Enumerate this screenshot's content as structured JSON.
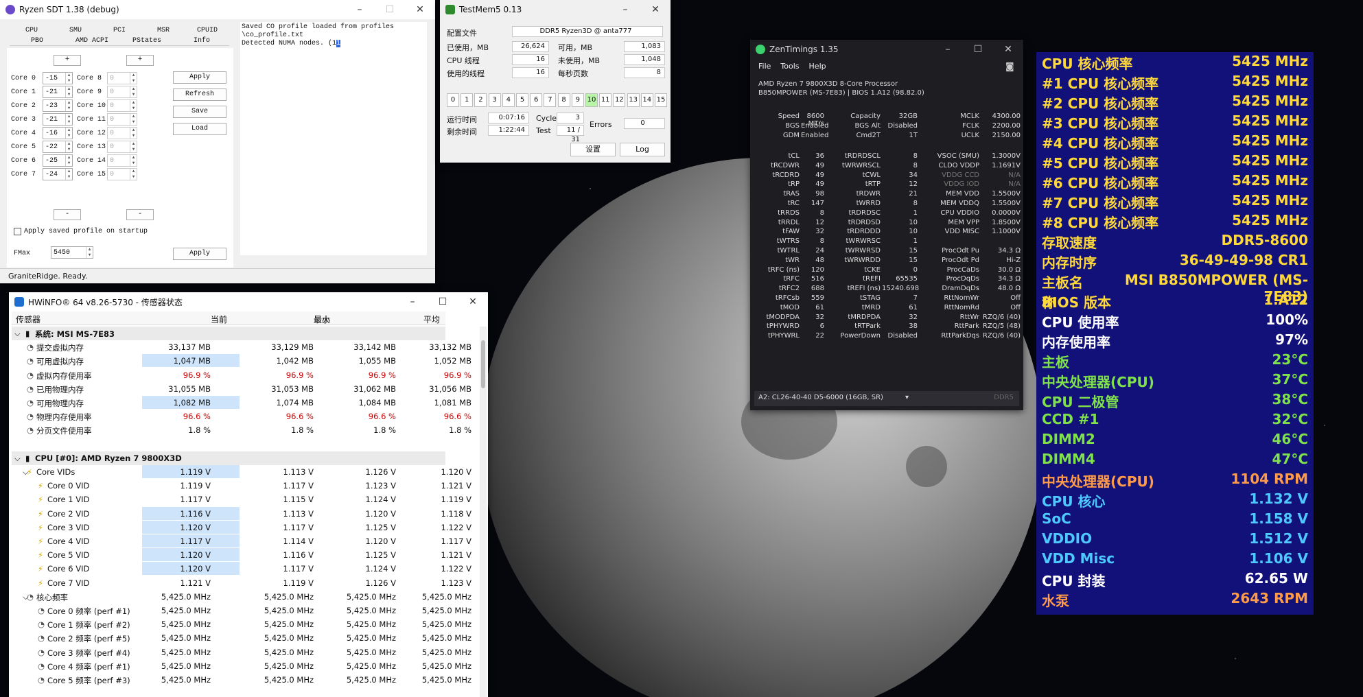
{
  "sdt": {
    "title": "Ryzen SDT 1.38 (debug)",
    "tabs_row1": [
      "CPU",
      "SMU",
      "PCI",
      "MSR",
      "CPUID"
    ],
    "tabs_row2": [
      "PBO",
      "AMD ACPI",
      "PStates",
      "Info"
    ],
    "plus": "+",
    "minus": "-",
    "cores_left": [
      {
        "label": "Core 0",
        "value": "-15"
      },
      {
        "label": "Core 1",
        "value": "-21"
      },
      {
        "label": "Core 2",
        "value": "-23"
      },
      {
        "label": "Core 3",
        "value": "-21"
      },
      {
        "label": "Core 4",
        "value": "-16"
      },
      {
        "label": "Core 5",
        "value": "-22"
      },
      {
        "label": "Core 6",
        "value": "-25"
      },
      {
        "label": "Core 7",
        "value": "-24"
      }
    ],
    "cores_right": [
      {
        "label": "Core 8",
        "value": "0"
      },
      {
        "label": "Core 9",
        "value": "0"
      },
      {
        "label": "Core 10",
        "value": "0"
      },
      {
        "label": "Core 11",
        "value": "0"
      },
      {
        "label": "Core 12",
        "value": "0"
      },
      {
        "label": "Core 13",
        "value": "0"
      },
      {
        "label": "Core 14",
        "value": "0"
      },
      {
        "label": "Core 15",
        "value": "0"
      }
    ],
    "buttons": {
      "apply": "Apply",
      "refresh": "Refresh",
      "save": "Save",
      "load": "Load",
      "apply2": "Apply"
    },
    "checkbox": "Apply saved profile on startup",
    "fmax_label": "FMax",
    "fmax_value": "5450",
    "log": [
      "Saved CO profile loaded from profiles",
      "\\co_profile.txt",
      "Detected NUMA nodes. (1"
    ],
    "status": "GraniteRidge. Ready."
  },
  "tm5": {
    "title": "TestMem5  0.13",
    "config_label": "配置文件",
    "config_value": "DDR5 Ryzen3D @ anta777",
    "rows": [
      {
        "l1": "已使用，MB",
        "v1": "26,624",
        "l2": "可用，MB",
        "v2": "1,083"
      },
      {
        "l1": "CPU 线程",
        "v1": "16",
        "l2": "未使用，MB",
        "v2": "1,048"
      },
      {
        "l1": "使用的线程",
        "v1": "16",
        "l2": "每秒页数",
        "v2": "8"
      }
    ],
    "tests": [
      "0",
      "1",
      "2",
      "3",
      "4",
      "5",
      "6",
      "7",
      "8",
      "9",
      "10",
      "11",
      "12",
      "13",
      "14",
      "15"
    ],
    "active_test": "10",
    "runtime_label": "运行时间",
    "runtime": "0:07:16",
    "cycle_label": "Cycle",
    "cycle": "3",
    "remain_label": "剩余时间",
    "remain": "1:22:44",
    "test_label": "Test",
    "test": "11 / 31",
    "errors_label": "Errors",
    "errors": "0",
    "btn_settings": "设置",
    "btn_log": "Log"
  },
  "zt": {
    "title": "ZenTimings 1.35",
    "menu": [
      "File",
      "Tools",
      "Help"
    ],
    "cpu": "AMD Ryzen 7 9800X3D 8-Core Processor",
    "board": "B850MPOWER (MS-7E83) | BIOS 1.A12 (98.82.0)",
    "top": [
      [
        "Speed",
        "8600 MT/s",
        "Capacity",
        "32GB",
        "MCLK",
        "4300.00"
      ],
      [
        "BGS",
        "Enabled",
        "BGS Alt",
        "Disabled",
        "FCLK",
        "2200.00"
      ],
      [
        "GDM",
        "Enabled",
        "Cmd2T",
        "1T",
        "UCLK",
        "2150.00"
      ]
    ],
    "rows": [
      [
        "tCL",
        "36",
        "tRDRDSCL",
        "8",
        "VSOC (SMU)",
        "1.3000V"
      ],
      [
        "tRCDWR",
        "49",
        "tWRWRSCL",
        "8",
        "CLDO VDDP",
        "1.1691V"
      ],
      [
        "tRCDRD",
        "49",
        "tCWL",
        "34",
        "VDDG CCD",
        "N/A"
      ],
      [
        "tRP",
        "49",
        "tRTP",
        "12",
        "VDDG IOD",
        "N/A"
      ],
      [
        "tRAS",
        "98",
        "tRDWR",
        "21",
        "MEM VDD",
        "1.5500V"
      ],
      [
        "tRC",
        "147",
        "tWRRD",
        "8",
        "MEM VDDQ",
        "1.5500V"
      ],
      [
        "tRRDS",
        "8",
        "tRDRDSC",
        "1",
        "CPU VDDIO",
        "0.0000V"
      ],
      [
        "tRRDL",
        "12",
        "tRDRDSD",
        "10",
        "MEM VPP",
        "1.8500V"
      ],
      [
        "tFAW",
        "32",
        "tRDRDDD",
        "10",
        "VDD MISC",
        "1.1000V"
      ],
      [
        "tWTRS",
        "8",
        "tWRWRSC",
        "1",
        "",
        ""
      ],
      [
        "tWTRL",
        "24",
        "tWRWRSD",
        "15",
        "ProcOdt Pu",
        "34.3 Ω"
      ],
      [
        "tWR",
        "48",
        "tWRWRDD",
        "15",
        "ProcOdt Pd",
        "Hi-Z"
      ],
      [
        "tRFC (ns)",
        "120",
        "tCKE",
        "0",
        "ProcCaDs",
        "30.0 Ω"
      ],
      [
        "tRFC",
        "516",
        "tREFI",
        "65535",
        "ProcDqDs",
        "34.3 Ω"
      ],
      [
        "tRFC2",
        "688",
        "tREFI (ns)",
        "15240.698",
        "DramDqDs",
        "48.0 Ω"
      ],
      [
        "tRFCsb",
        "559",
        "tSTAG",
        "7",
        "RttNomWr",
        "Off"
      ],
      [
        "tMOD",
        "61",
        "tMRD",
        "61",
        "RttNomRd",
        "Off"
      ],
      [
        "tMODPDA",
        "32",
        "tMRDPDA",
        "32",
        "RttWr",
        "RZQ/6 (40)"
      ],
      [
        "tPHYWRD",
        "6",
        "tRTPark",
        "38",
        "RttPark",
        "RZQ/5 (48)"
      ],
      [
        "tPHYWRL",
        "22",
        "PowerDown",
        "Disabled",
        "RttParkDqs",
        "RZQ/6 (40)"
      ]
    ],
    "dimm": "A2: CL26-40-40 D5-6000 (16GB, SR)",
    "ddr": "DDR5"
  },
  "hw": {
    "title": "HWiNFO® 64 v8.26-5730 - 传感器状态",
    "headers": [
      "传感器",
      "当前",
      "最小",
      "最大",
      "平均"
    ],
    "rows": [
      {
        "t": "g",
        "name": "系统: MSI MS-7E83"
      },
      {
        "name": "提交虚拟内存",
        "v": [
          "33,137 MB",
          "33,129 MB",
          "33,142 MB",
          "33,132 MB"
        ]
      },
      {
        "name": "可用虚拟内存",
        "v": [
          "1,047 MB",
          "1,042 MB",
          "1,055 MB",
          "1,052 MB"
        ],
        "hl": 1
      },
      {
        "name": "虚拟内存使用率",
        "v": [
          "96.9 %",
          "96.9 %",
          "96.9 %",
          "96.9 %"
        ],
        "red": 1
      },
      {
        "name": "已用物理内存",
        "v": [
          "31,055 MB",
          "31,053 MB",
          "31,062 MB",
          "31,056 MB"
        ]
      },
      {
        "name": "可用物理内存",
        "v": [
          "1,082 MB",
          "1,074 MB",
          "1,084 MB",
          "1,081 MB"
        ],
        "hl": 1
      },
      {
        "name": "物理内存使用率",
        "v": [
          "96.6 %",
          "96.6 %",
          "96.6 %",
          "96.6 %"
        ],
        "red": 1
      },
      {
        "name": "分页文件使用率",
        "v": [
          "1.8 %",
          "1.8 %",
          "1.8 %",
          "1.8 %"
        ]
      },
      {
        "t": "e"
      },
      {
        "t": "g",
        "name": "CPU [#0]: AMD Ryzen 7 9800X3D"
      },
      {
        "name": "Core VIDs",
        "v": [
          "1.119 V",
          "1.113 V",
          "1.126 V",
          "1.120 V"
        ],
        "hl": 1,
        "bolt": 1
      },
      {
        "name": "Core 0 VID",
        "v": [
          "1.119 V",
          "1.117 V",
          "1.123 V",
          "1.121 V"
        ],
        "bolt": 1,
        "sub": 1
      },
      {
        "name": "Core 1 VID",
        "v": [
          "1.117 V",
          "1.115 V",
          "1.124 V",
          "1.119 V"
        ],
        "bolt": 1,
        "sub": 1
      },
      {
        "name": "Core 2 VID",
        "v": [
          "1.116 V",
          "1.113 V",
          "1.120 V",
          "1.118 V"
        ],
        "hl": 1,
        "bolt": 1,
        "sub": 1
      },
      {
        "name": "Core 3 VID",
        "v": [
          "1.120 V",
          "1.117 V",
          "1.125 V",
          "1.122 V"
        ],
        "hl": 1,
        "bolt": 1,
        "sub": 1
      },
      {
        "name": "Core 4 VID",
        "v": [
          "1.117 V",
          "1.114 V",
          "1.120 V",
          "1.117 V"
        ],
        "hl": 1,
        "bolt": 1,
        "sub": 1
      },
      {
        "name": "Core 5 VID",
        "v": [
          "1.120 V",
          "1.116 V",
          "1.125 V",
          "1.121 V"
        ],
        "hl": 1,
        "bolt": 1,
        "sub": 1
      },
      {
        "name": "Core 6 VID",
        "v": [
          "1.120 V",
          "1.117 V",
          "1.124 V",
          "1.122 V"
        ],
        "hl": 1,
        "bolt": 1,
        "sub": 1
      },
      {
        "name": "Core 7 VID",
        "v": [
          "1.121 V",
          "1.119 V",
          "1.126 V",
          "1.123 V"
        ],
        "bolt": 1,
        "sub": 1
      },
      {
        "name": "核心频率",
        "v": [
          "5,425.0 MHz",
          "5,425.0 MHz",
          "5,425.0 MHz",
          "5,425.0 MHz"
        ]
      },
      {
        "name": "Core 0 频率 (perf #1)",
        "v": [
          "5,425.0 MHz",
          "5,425.0 MHz",
          "5,425.0 MHz",
          "5,425.0 MHz"
        ],
        "sub": 1
      },
      {
        "name": "Core 1 频率 (perf #2)",
        "v": [
          "5,425.0 MHz",
          "5,425.0 MHz",
          "5,425.0 MHz",
          "5,425.0 MHz"
        ],
        "sub": 1
      },
      {
        "name": "Core 2 频率 (perf #5)",
        "v": [
          "5,425.0 MHz",
          "5,425.0 MHz",
          "5,425.0 MHz",
          "5,425.0 MHz"
        ],
        "sub": 1
      },
      {
        "name": "Core 3 频率 (perf #4)",
        "v": [
          "5,425.0 MHz",
          "5,425.0 MHz",
          "5,425.0 MHz",
          "5,425.0 MHz"
        ],
        "sub": 1
      },
      {
        "name": "Core 4 频率 (perf #1)",
        "v": [
          "5,425.0 MHz",
          "5,425.0 MHz",
          "5,425.0 MHz",
          "5,425.0 MHz"
        ],
        "sub": 1
      },
      {
        "name": "Core 5 频率 (perf #3)",
        "v": [
          "5,425.0 MHz",
          "5,425.0 MHz",
          "5,425.0 MHz",
          "5,425.0 MHz"
        ],
        "sub": 1
      }
    ]
  },
  "osd": {
    "rows": [
      {
        "l": "CPU 核心频率",
        "v": "5425 MHz",
        "c": "#ffd83a"
      },
      {
        "l": "#1 CPU 核心频率",
        "v": "5425 MHz",
        "c": "#ffd83a"
      },
      {
        "l": "#2 CPU 核心频率",
        "v": "5425 MHz",
        "c": "#ffd83a"
      },
      {
        "l": "#3 CPU 核心频率",
        "v": "5425 MHz",
        "c": "#ffd83a"
      },
      {
        "l": "#4 CPU 核心频率",
        "v": "5425 MHz",
        "c": "#ffd83a"
      },
      {
        "l": "#5 CPU 核心频率",
        "v": "5425 MHz",
        "c": "#ffd83a"
      },
      {
        "l": "#6 CPU 核心频率",
        "v": "5425 MHz",
        "c": "#ffd83a"
      },
      {
        "l": "#7 CPU 核心频率",
        "v": "5425 MHz",
        "c": "#ffd83a"
      },
      {
        "l": "#8 CPU 核心频率",
        "v": "5425 MHz",
        "c": "#ffd83a"
      },
      {
        "l": "存取速度",
        "v": "DDR5-8600",
        "c": "#ffd83a"
      },
      {
        "l": "内存时序",
        "v": "36-49-49-98 CR1",
        "c": "#ffd83a"
      },
      {
        "l": "主板名称",
        "v": "MSI B850MPOWER (MS-7E83)",
        "c": "#ffd83a"
      },
      {
        "l": "BIOS 版本",
        "v": "1.A12",
        "c": "#ffd83a"
      },
      {
        "l": "CPU 使用率",
        "v": "100%",
        "c": "#ffffff"
      },
      {
        "l": "内存使用率",
        "v": "97%",
        "c": "#ffffff"
      },
      {
        "l": "主板",
        "v": "23°C",
        "c": "#7fe24a"
      },
      {
        "l": "中央处理器(CPU)",
        "v": "37°C",
        "c": "#7fe24a"
      },
      {
        "l": "CPU 二极管",
        "v": "38°C",
        "c": "#7fe24a"
      },
      {
        "l": "CCD #1",
        "v": "32°C",
        "c": "#7fe24a"
      },
      {
        "l": "DIMM2",
        "v": "46°C",
        "c": "#7fe24a"
      },
      {
        "l": "DIMM4",
        "v": "47°C",
        "c": "#7fe24a"
      },
      {
        "l": "中央处理器(CPU)",
        "v": "1104 RPM",
        "c": "#ff9b48"
      },
      {
        "l": "CPU 核心",
        "v": "1.132 V",
        "c": "#4ec9ff"
      },
      {
        "l": "SoC",
        "v": "1.158 V",
        "c": "#4ec9ff"
      },
      {
        "l": "VDDIO",
        "v": "1.512 V",
        "c": "#4ec9ff"
      },
      {
        "l": "VDD Misc",
        "v": "1.106 V",
        "c": "#4ec9ff"
      },
      {
        "l": "CPU 封装",
        "v": "62.65 W",
        "c": "#ffffff"
      },
      {
        "l": "水泵",
        "v": "2643 RPM",
        "c": "#ff9b48"
      }
    ]
  }
}
